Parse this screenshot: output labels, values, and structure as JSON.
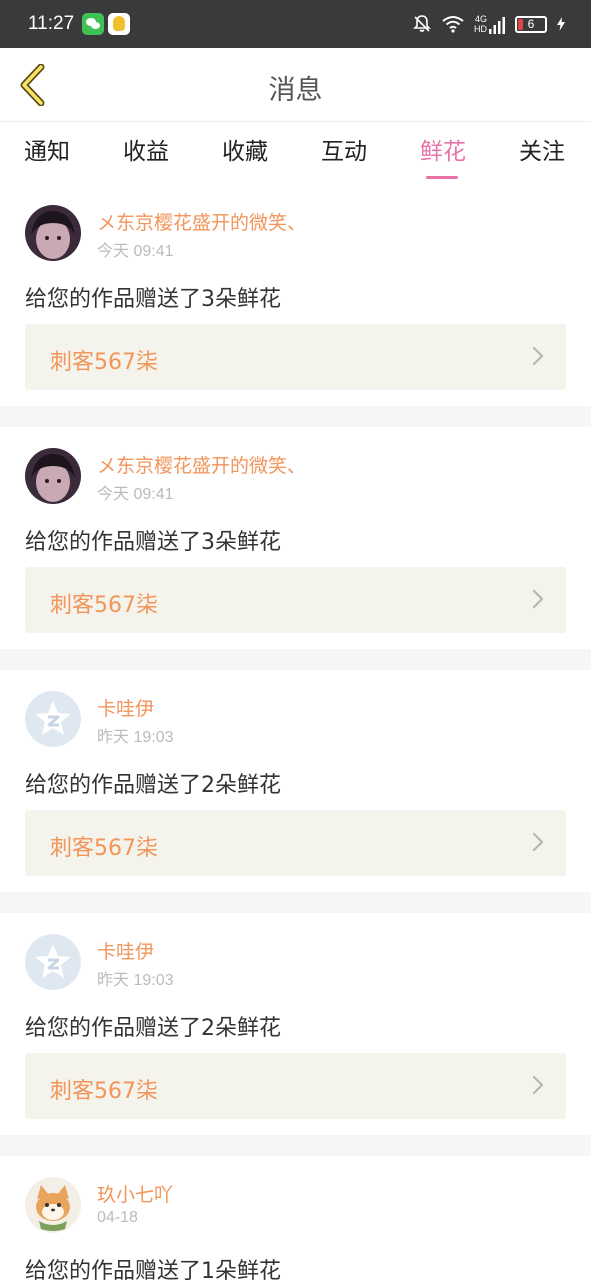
{
  "status_bar": {
    "time": "11:27",
    "network": "4G",
    "hd": "HD",
    "battery": "6"
  },
  "header": {
    "title": "消息"
  },
  "tabs": [
    {
      "label": "通知",
      "active": false
    },
    {
      "label": "收益",
      "active": false
    },
    {
      "label": "收藏",
      "active": false
    },
    {
      "label": "互动",
      "active": false
    },
    {
      "label": "鲜花",
      "active": true
    },
    {
      "label": "关注",
      "active": false
    }
  ],
  "colors": {
    "accent_pink": "#e873a9",
    "name_orange": "#f2955a",
    "link_bg": "#f5f4ec"
  },
  "messages": [
    {
      "avatar": "user-photo-avatar",
      "user": "メ东京樱花盛开的微笑、",
      "time": "今天 09:41",
      "text": "给您的作品赠送了3朵鲜花",
      "work": "刺客567柒"
    },
    {
      "avatar": "user-photo-avatar",
      "user": "メ东京樱花盛开的微笑、",
      "time": "今天 09:41",
      "text": "给您的作品赠送了3朵鲜花",
      "work": "刺客567柒"
    },
    {
      "avatar": "default-star-avatar",
      "user": "卡哇伊",
      "time": "昨天 19:03",
      "text": "给您的作品赠送了2朵鲜花",
      "work": "刺客567柒"
    },
    {
      "avatar": "default-star-avatar",
      "user": "卡哇伊",
      "time": "昨天 19:03",
      "text": "给您的作品赠送了2朵鲜花",
      "work": "刺客567柒"
    },
    {
      "avatar": "shiba-dog-avatar",
      "user": "玖小七吖",
      "time": "04-18",
      "text": "给您的作品赠送了1朵鲜花",
      "work": ""
    }
  ]
}
